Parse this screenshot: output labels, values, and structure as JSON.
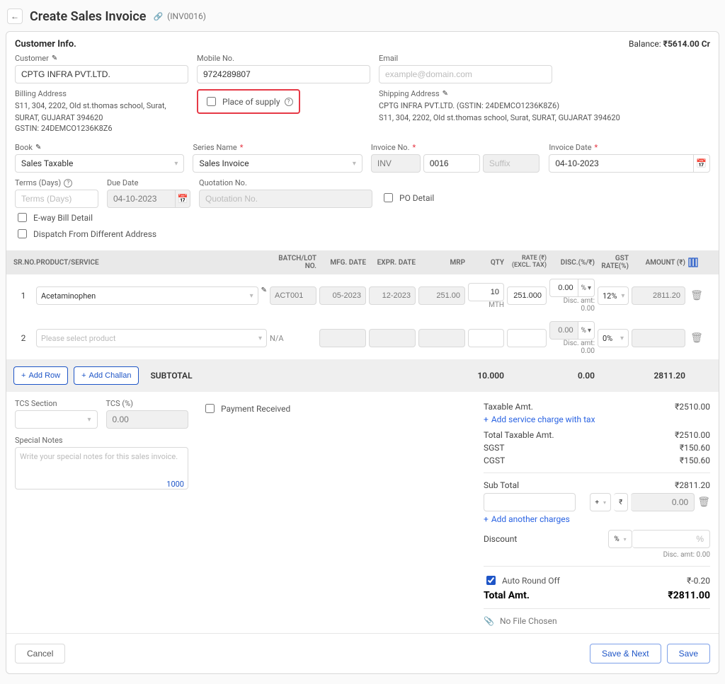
{
  "header": {
    "title": "Create Sales Invoice",
    "invoice_id": "(INV0016)"
  },
  "balance": {
    "label": "Balance:",
    "value": "₹5614.00 Cr"
  },
  "customer_info": {
    "section_title": "Customer Info.",
    "customer_label": "Customer",
    "customer_value": "CPTG INFRA PVT.LTD.",
    "mobile_label": "Mobile No.",
    "mobile_value": "9724289807",
    "email_label": "Email",
    "email_placeholder": "example@domain.com",
    "billing_label": "Billing Address",
    "billing_line1": "S11, 304, 2202, Old st.thomas school, Surat, SURAT, GUJARAT 394620",
    "billing_gstin_label": "GSTIN:",
    "billing_gstin": "24DEMCO1236K8Z6",
    "place_of_supply_label": "Place of supply",
    "shipping_label": "Shipping Address",
    "shipping_name": "CPTG INFRA PVT.LTD.",
    "shipping_gstin_prefix": "GSTIN:",
    "shipping_gstin": "24DEMCO1236K8Z6",
    "shipping_line1": "S11, 304, 2202, Old st.thomas school, Surat, SURAT, GUJARAT 394620"
  },
  "invoice_meta": {
    "book_label": "Book",
    "book_value": "Sales Taxable",
    "series_label": "Series Name",
    "series_value": "Sales Invoice",
    "invoice_no_label": "Invoice No.",
    "invoice_no_prefix": "INV",
    "invoice_no_num": "0016",
    "invoice_no_suffix_placeholder": "Suffix",
    "invoice_date_label": "Invoice Date",
    "invoice_date_value": "04-10-2023",
    "terms_label": "Terms (Days)",
    "terms_placeholder": "Terms (Days)",
    "due_date_label": "Due Date",
    "due_date_value": "04-10-2023",
    "quotation_label": "Quotation No.",
    "quotation_placeholder": "Quotation No.",
    "po_detail_label": "PO Detail",
    "eway_label": "E-way Bill Detail",
    "dispatch_label": "Dispatch From Different Address"
  },
  "table": {
    "columns": {
      "srno": "SR.NO.",
      "product": "PRODUCT/SERVICE",
      "batch": "BATCH/LOT NO.",
      "mfg": "MFG. DATE",
      "exp": "EXPR. DATE",
      "mrp": "MRP",
      "qty": "QTY",
      "rate": "RATE (₹)\n(EXCL. TAX)",
      "disc": "DISC.(%/₹)",
      "gst": "GST RATE(%)",
      "amount": "AMOUNT (₹)"
    },
    "rows": [
      {
        "sr": "1",
        "product": "Acetaminophen",
        "batch": "ACT001",
        "mfg": "05-2023",
        "exp": "12-2023",
        "mrp": "251.00",
        "qty": "10",
        "qty_unit": "MTH",
        "rate": "251.000",
        "disc": "0.00",
        "disc_unit": "%",
        "disc_amt_label": "Disc. amt: 0.00",
        "gst": "12%",
        "amount": "2811.20"
      },
      {
        "sr": "2",
        "product_placeholder": "Please select product",
        "batch": "N/A",
        "mfg": "",
        "exp": "",
        "mrp": "",
        "qty": "",
        "rate": "",
        "disc": "0.00",
        "disc_unit": "%",
        "disc_amt_label": "Disc. amt: 0.00",
        "gst": "0%",
        "amount": ""
      }
    ],
    "subtotal_label": "SUBTOTAL",
    "subtotal_qty": "10.000",
    "subtotal_disc": "0.00",
    "subtotal_amount": "2811.20",
    "add_row": "Add Row",
    "add_challan": "Add Challan"
  },
  "bottom_left": {
    "tcs_section_label": "TCS Section",
    "tcs_pct_label": "TCS (%)",
    "tcs_pct_value": "0.00",
    "notes_label": "Special Notes",
    "notes_placeholder": "Write your special notes for this sales invoice.",
    "notes_counter": "1000",
    "payment_received_label": "Payment Received"
  },
  "totals": {
    "taxable_label": "Taxable Amt.",
    "taxable_value": "₹2510.00",
    "add_service_label": "Add service charge with tax",
    "total_taxable_label": "Total Taxable Amt.",
    "total_taxable_value": "₹2510.00",
    "sgst_label": "SGST",
    "sgst_value": "₹150.60",
    "cgst_label": "CGST",
    "cgst_value": "₹150.60",
    "subtotal_label": "Sub Total",
    "subtotal_value": "₹2811.20",
    "extra_charge_value": "0.00",
    "add_charge_label": "Add another charges",
    "discount_label": "Discount",
    "discount_unit": "%",
    "discount_amt_label": "Disc. amt: 0.00",
    "round_off_label": "Auto Round Off",
    "round_off_value": "₹-0.20",
    "total_amt_label": "Total Amt.",
    "total_amt_value": "₹2811.00",
    "file_label": "No File Chosen"
  },
  "footer": {
    "cancel": "Cancel",
    "save_next": "Save & Next",
    "save": "Save"
  }
}
